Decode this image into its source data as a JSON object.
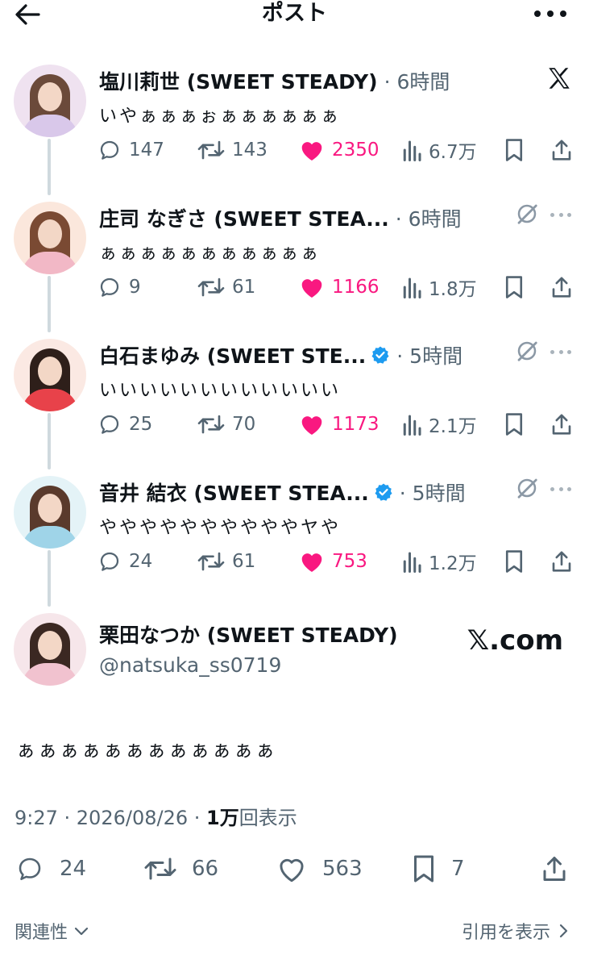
{
  "header": {
    "title": "ポスト"
  },
  "thread": [
    {
      "name": "塩川莉世 (SWEET STEADY)",
      "verified": false,
      "time": "· 6時間",
      "text": "いやぁぁぁぉぁぁぁぁぁぁ",
      "replies": "147",
      "reposts": "143",
      "likes": "2350",
      "views": "6.7万",
      "corner": "x-logo",
      "avatar_colors": {
        "bg": "#efe2f0",
        "hair": "#6b4a3a",
        "body": "#d9c8ea"
      }
    },
    {
      "name": "庄司 なぎさ (SWEET STEA...",
      "verified": false,
      "time": "· 6時間",
      "text": "ぁぁぁぁぁぁぁぁぁぁぁ",
      "replies": "9",
      "reposts": "61",
      "likes": "1166",
      "views": "1.8万",
      "corner": "grok",
      "avatar_colors": {
        "bg": "#fbe7dc",
        "hair": "#7a4a33",
        "body": "#f2b8c6"
      }
    },
    {
      "name": "白石まゆみ (SWEET STE...",
      "verified": true,
      "time": "· 5時間",
      "text": "いいいいいいいいいいいい",
      "replies": "25",
      "reposts": "70",
      "likes": "1173",
      "views": "2.1万",
      "corner": "grok",
      "avatar_colors": {
        "bg": "#fbe9e3",
        "hair": "#2e1f1a",
        "body": "#e8424a"
      }
    },
    {
      "name": "音井 結衣 (SWEET STEA...",
      "verified": true,
      "time": "· 5時間",
      "text": "ややややややややややヤや",
      "replies": "24",
      "reposts": "61",
      "likes": "753",
      "views": "1.2万",
      "corner": "grok",
      "avatar_colors": {
        "bg": "#e4f3f7",
        "hair": "#5a3a2c",
        "body": "#9fd4e8"
      }
    }
  ],
  "main_post": {
    "name": "栗田なつか (SWEET STEADY)",
    "handle": "@natsuka_ss0719",
    "brand": "𝕏.com",
    "text": "ぁぁぁぁぁぁぁぁぁぁぁぁ",
    "meta_time": "9:27 · 2026/08/26 · ",
    "meta_views_num": "1万",
    "meta_views_label": "回表示",
    "replies": "24",
    "reposts": "66",
    "likes": "563",
    "bookmarks": "7",
    "avatar_colors": {
      "bg": "#f6e6ea",
      "hair": "#3b2822",
      "body": "#f1c2cf"
    }
  },
  "footer": {
    "related_label": "関連性",
    "quotes_label": "引用を表示"
  },
  "colors": {
    "like": "#f91880",
    "muted": "#536471",
    "verified": "#1d9bf0",
    "line": "#cfd9de"
  }
}
